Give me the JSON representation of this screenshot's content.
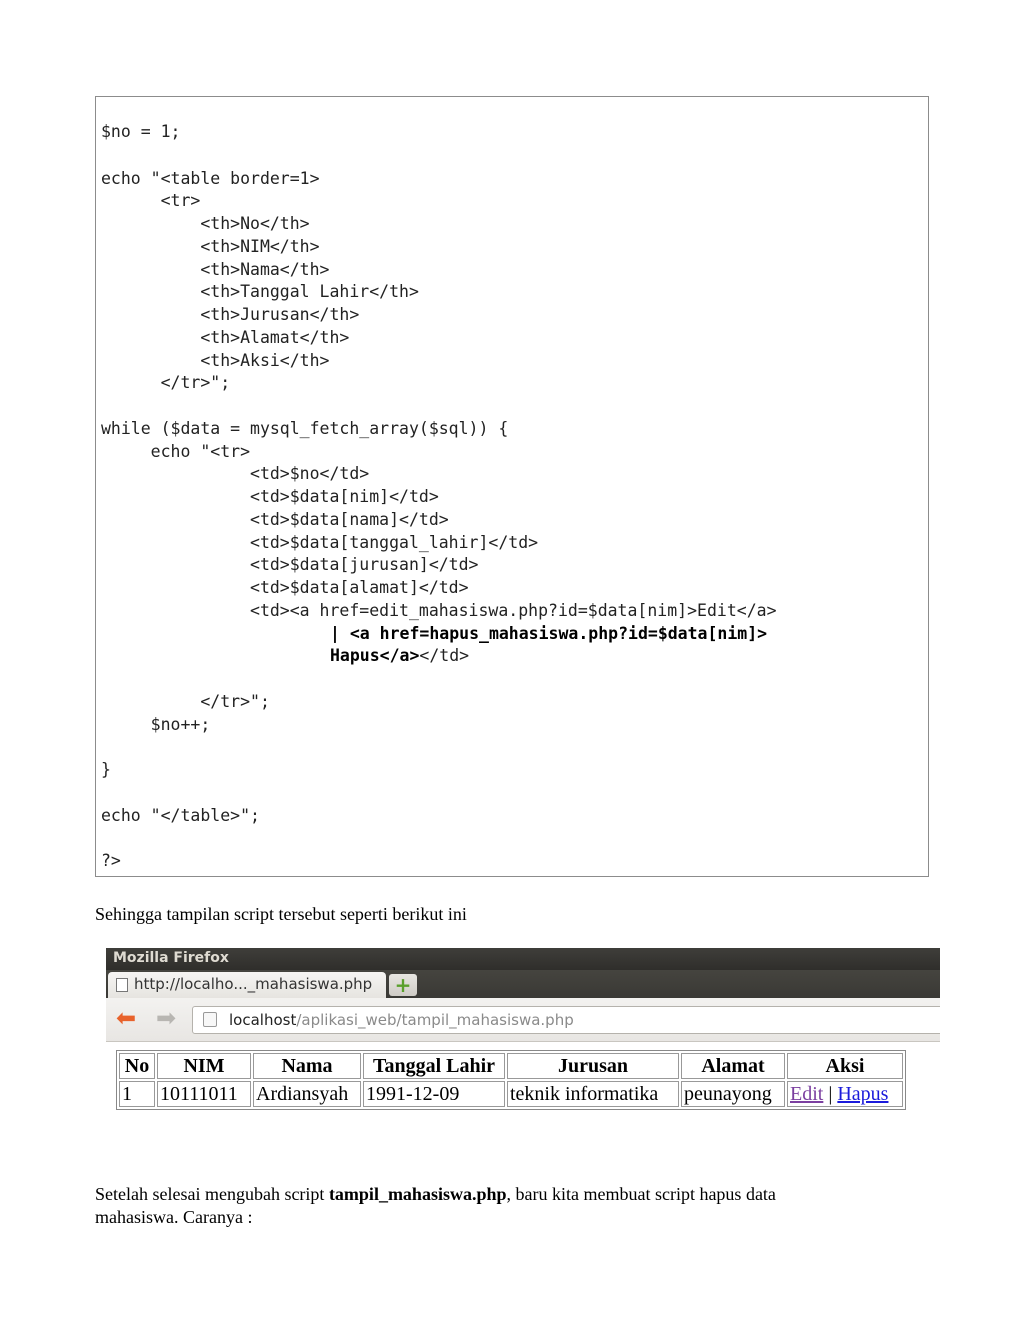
{
  "code": {
    "lines": [
      "$no = 1;",
      "echo \"<table border=1>",
      "      <tr>",
      "          <th>No</th>",
      "          <th>NIM</th>",
      "          <th>Nama</th>",
      "          <th>Tanggal Lahir</th>",
      "          <th>Jurusan</th>",
      "          <th>Alamat</th>",
      "          <th>Aksi</th>",
      "      </tr>\";",
      "while ($data = mysql_fetch_array($sql)) {",
      "     echo \"<tr>",
      "               <td>$no</td>",
      "               <td>$data[nim]</td>",
      "               <td>$data[nama]</td>",
      "               <td>$data[tanggal_lahir]</td>",
      "               <td>$data[jurusan]</td>",
      "               <td>$data[alamat]</td>",
      "               <td><a href=edit_mahasiswa.php?id=$data[nim]>Edit</a>",
      "          </tr>\";",
      "     $no++;",
      "}",
      "echo \"</table>\";",
      "?>"
    ],
    "bold_line_1": "| <a href=hapus_mahasiswa.php?id=$data[nim]>",
    "bold_line_2": "Hapus</a>",
    "bold_line_2_tail": "</td>"
  },
  "paragraph_1": "Sehingga tampilan script tersebut seperti berikut ini",
  "browser": {
    "window_title": "Mozilla Firefox",
    "tab_title": "http://localho..._mahasiswa.php",
    "new_tab_symbol": "+",
    "url_host": "localhost",
    "url_path": "/aplikasi_web/tampil_mahasiswa.php",
    "table": {
      "headers": [
        "No",
        "NIM",
        "Nama",
        "Tanggal Lahir",
        "Jurusan",
        "Alamat",
        "Aksi"
      ],
      "row": {
        "no": "1",
        "nim": "10111011",
        "nama": "Ardiansyah",
        "tanggal_lahir": "1991-12-09",
        "jurusan": "teknik informatika",
        "alamat": "peunayong",
        "edit": "Edit",
        "separator": "|",
        "hapus": "Hapus"
      }
    }
  },
  "paragraph_2": {
    "before": "Setelah selesai mengubah script ",
    "bold": "tampil_mahasiswa.php",
    "after": ", baru kita membuat script hapus data",
    "line2": "mahasiswa. Caranya :"
  }
}
